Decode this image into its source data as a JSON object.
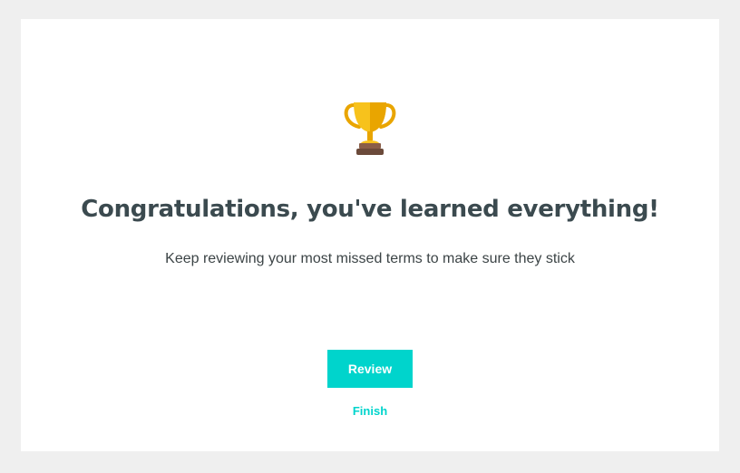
{
  "completion": {
    "icon": "trophy-icon",
    "title": "Congratulations, you've learned everything!",
    "subtitle": "Keep reviewing your most missed terms to make sure they stick",
    "review_label": "Review",
    "finish_label": "Finish"
  },
  "colors": {
    "accent": "#00d4cc",
    "title": "#3b4a4f",
    "background": "#efefef",
    "card": "#ffffff",
    "trophy_gold": "#f7c21c",
    "trophy_base": "#6b4a3a"
  }
}
